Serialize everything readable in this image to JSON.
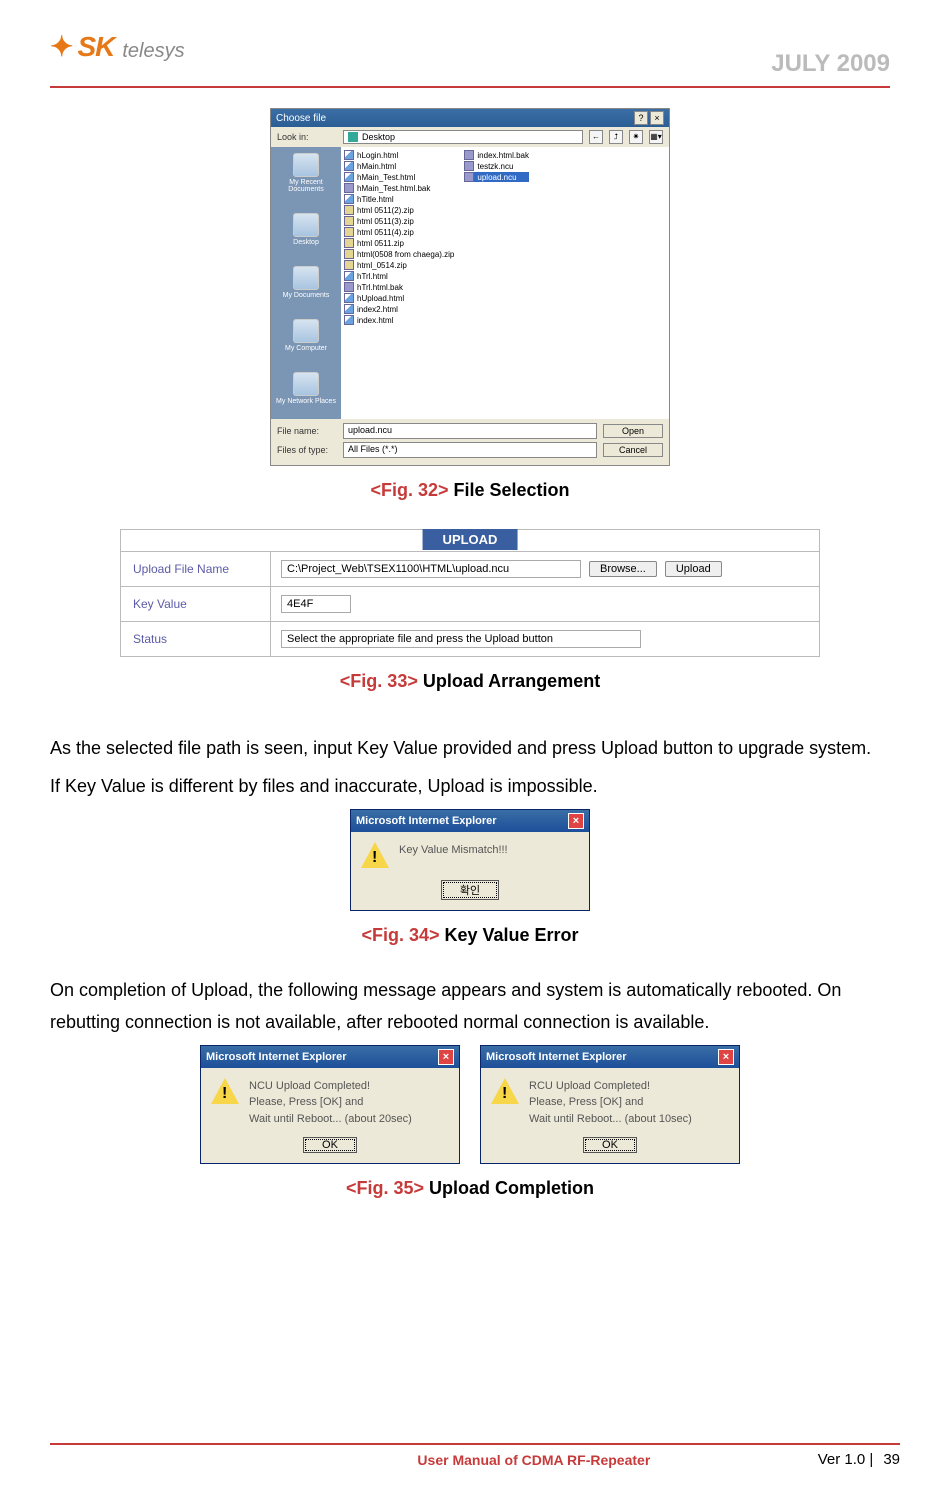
{
  "header": {
    "date": "JULY 2009",
    "logo_sk": "SK",
    "logo_telesys": "telesys"
  },
  "dialog": {
    "title": "Choose file",
    "lookin_label": "Look in:",
    "lookin_value": "Desktop",
    "places": [
      "My Recent Documents",
      "Desktop",
      "My Documents",
      "My Computer",
      "My Network Places"
    ],
    "files_col1": [
      "hLogin.html",
      "hMain.html",
      "hMain_Test.html",
      "hMain_Test.html.bak",
      "hTitle.html",
      "html 0511(2).zip",
      "html 0511(3).zip",
      "html 0511(4).zip",
      "html 0511.zip",
      "html(0508 from chaega).zip",
      "html_0514.zip",
      "hTrl.html",
      "hTrl.html.bak",
      "hUpload.html",
      "index2.html",
      "index.html"
    ],
    "files_col2": [
      "index.html.bak",
      "testzk.ncu",
      "upload.ncu"
    ],
    "filename_label": "File name:",
    "filename_value": "upload.ncu",
    "filetype_label": "Files of type:",
    "filetype_value": "All Files (*.*)",
    "open": "Open",
    "cancel": "Cancel"
  },
  "captions": {
    "fig32_pre": "<Fig. 32> ",
    "fig32": "File Selection",
    "fig33_pre": "<Fig. 33> ",
    "fig33": "Upload Arrangement",
    "fig34_pre": "<Fig. 34> ",
    "fig34": "Key Value Error",
    "fig35_pre": "<Fig. 35> ",
    "fig35": "Upload Completion"
  },
  "upload": {
    "header": "UPLOAD",
    "row1_label": "Upload File Name",
    "row1_value": "C:\\Project_Web\\TSEX1100\\HTML\\upload.ncu",
    "browse": "Browse...",
    "uploadbtn": "Upload",
    "row2_label": "Key Value",
    "row2_value": "4E4F",
    "row3_label": "Status",
    "row3_value": "Select the appropriate file and press the Upload button"
  },
  "para1": "As the selected file path is seen, input Key Value provided and press Upload button to upgrade system.",
  "para2": "If Key Value is different by files and inaccurate, Upload is impossible.",
  "para3": "On completion of Upload, the following message appears and system is automatically rebooted. On rebutting connection is not available, after rebooted normal connection is available.",
  "msg34": {
    "title": "Microsoft Internet Explorer",
    "text": "Key Value Mismatch!!!",
    "ok": "확인"
  },
  "msg35a": {
    "title": "Microsoft Internet Explorer",
    "l1": "NCU Upload Completed!",
    "l2": "Please, Press [OK] and",
    "l3": "Wait until Reboot... (about 20sec)",
    "ok": "OK"
  },
  "msg35b": {
    "title": "Microsoft Internet Explorer",
    "l1": "RCU Upload Completed!",
    "l2": "Please, Press [OK] and",
    "l3": "Wait until Reboot... (about 10sec)",
    "ok": "OK"
  },
  "footer": {
    "center": "User Manual of CDMA RF-Repeater",
    "ver": "Ver 1.0 |",
    "page": "39"
  }
}
